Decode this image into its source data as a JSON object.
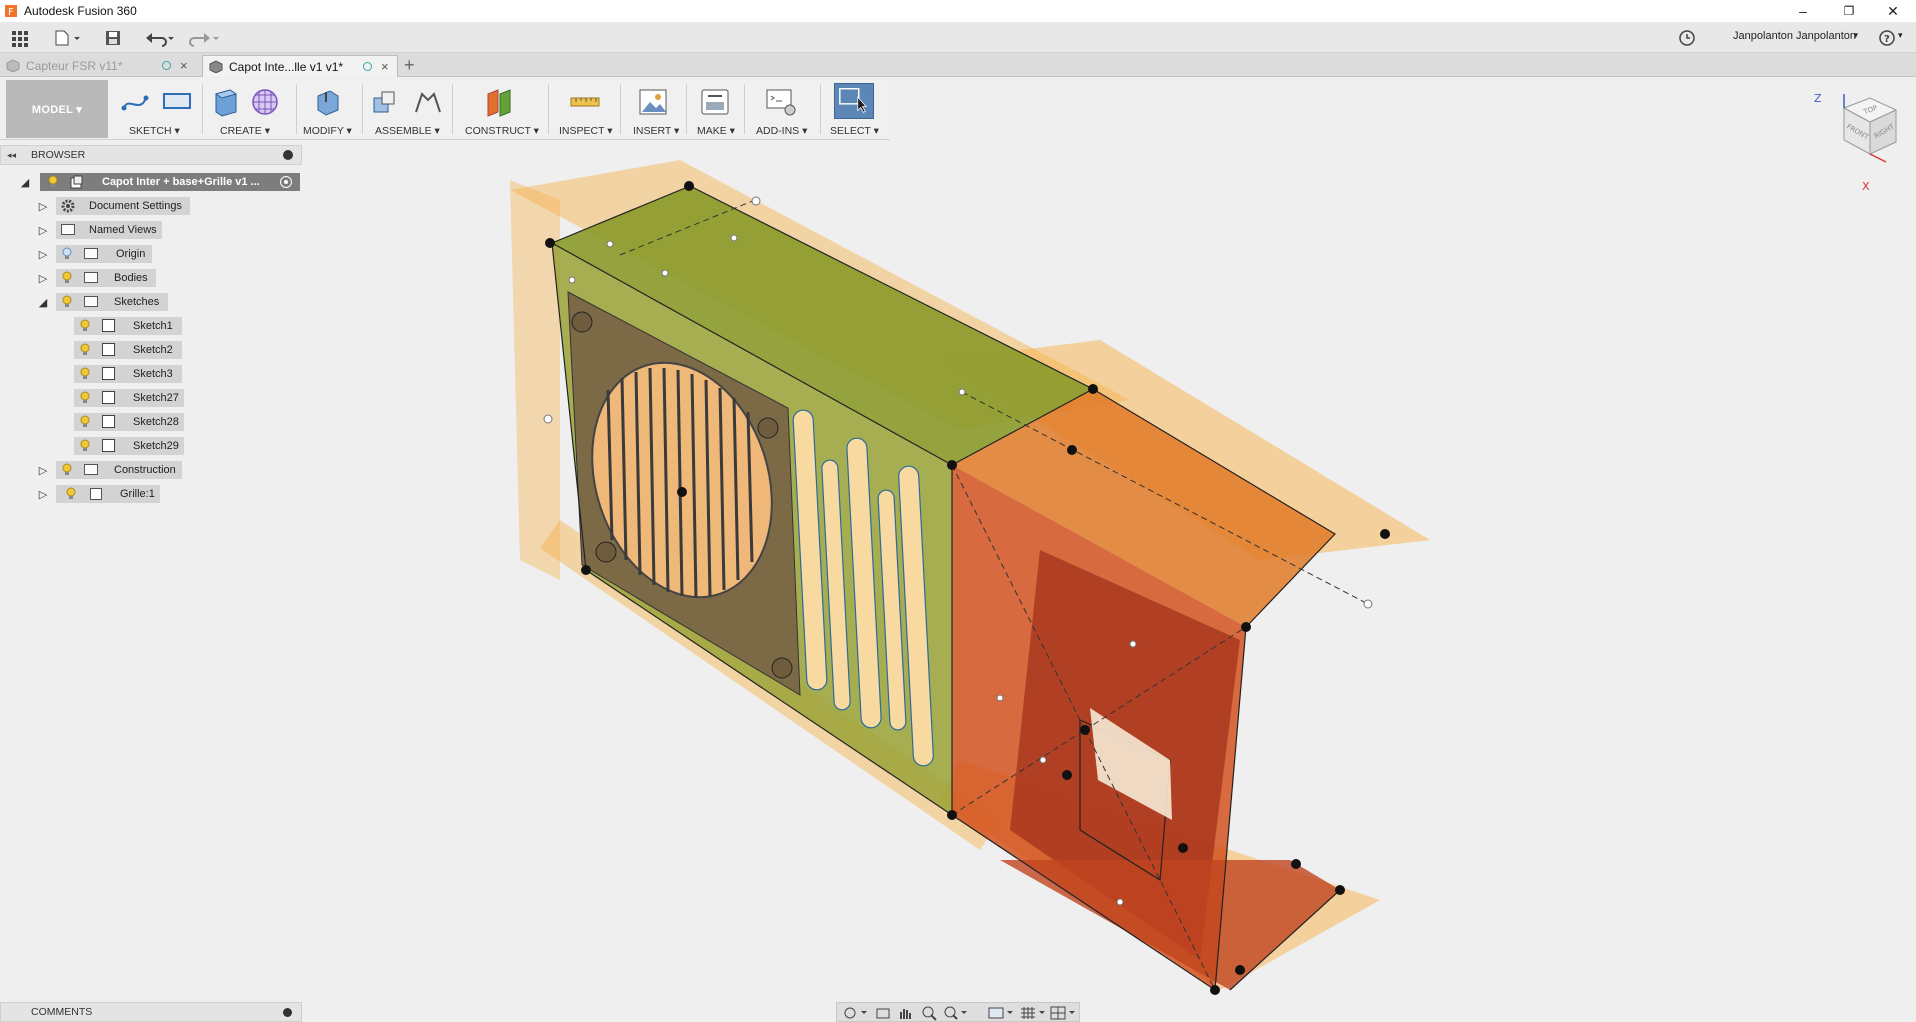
{
  "window": {
    "title": "Autodesk Fusion 360",
    "minimize": "–",
    "restore": "❐",
    "close": "✕"
  },
  "appbar": {
    "user": "Janpolanton Janpolanton",
    "user_caret": "▾",
    "help": "?",
    "help_caret": "▾"
  },
  "tabs": [
    {
      "label": "Capteur FSR v11*",
      "active": false
    },
    {
      "label": "Capot Inte...lle v1 v1*",
      "active": true
    }
  ],
  "tab_add": "+",
  "toolbar": {
    "workspace": "MODEL ▾",
    "groups": [
      "SKETCH ▾",
      "CREATE ▾",
      "MODIFY ▾",
      "ASSEMBLE ▾",
      "CONSTRUCT ▾",
      "INSPECT ▾",
      "INSERT ▾",
      "MAKE ▾",
      "ADD-INS ▾",
      "SELECT ▾"
    ]
  },
  "browser": {
    "header": "BROWSER",
    "collapse": "◂◂",
    "root": "Capot Inter + base+Grille v1 ...",
    "items": {
      "document_settings": "Document Settings",
      "named_views": "Named Views",
      "origin": "Origin",
      "bodies": "Bodies",
      "sketches": "Sketches",
      "construction": "Construction",
      "grille": "Grille:1"
    },
    "sketches": [
      "Sketch1",
      "Sketch2",
      "Sketch3",
      "Sketch27",
      "Sketch28",
      "Sketch29"
    ]
  },
  "comments": {
    "header": "COMMENTS"
  },
  "viewcube": {
    "top": "TOP",
    "front": "FRONT",
    "right": "RIGHT",
    "z": "Z",
    "x": "X"
  },
  "colors": {
    "accent": "#5b86b5",
    "plane": "#f7b24a",
    "body_green": "#8a9a2a",
    "body_orange": "#d2521e",
    "body_red": "#a8341e"
  }
}
